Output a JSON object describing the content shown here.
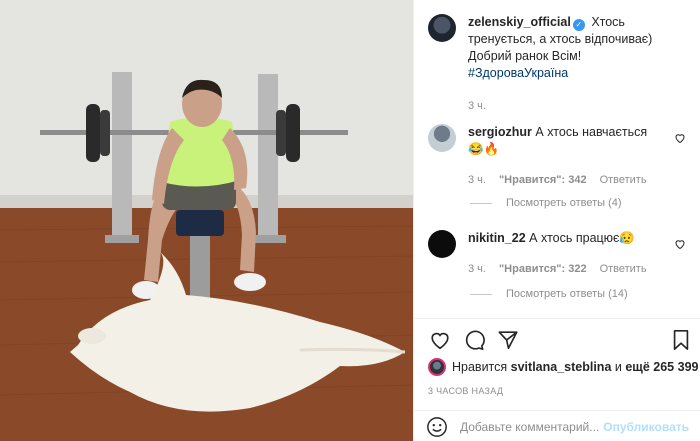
{
  "post": {
    "username": "zelenskiy_official",
    "verified_mark": "✓",
    "caption": "Хтось тренується, а хтось відпочиває) Добрий ранок Всім!",
    "hashtag": "#ЗдороваУкраїна",
    "time": "3 ч."
  },
  "comments": [
    {
      "username": "sergiozhur",
      "text": "А хтось навчається",
      "emoji": "😂🔥",
      "time": "3 ч.",
      "likes": "\"Нравится\": 342",
      "reply": "Ответить",
      "view_replies": "Посмотреть ответы (4)"
    },
    {
      "username": "nikitin_22",
      "text": "А хтось працює😥",
      "time": "3 ч.",
      "likes": "\"Нравится\": 322",
      "reply": "Ответить",
      "view_replies": "Посмотреть ответы (14)"
    }
  ],
  "likes_line": {
    "prefix": "Нравится",
    "user": "svitlana_steblina",
    "middle": "и",
    "rest": "ещё 265 399"
  },
  "time_ago": "3 ЧАСОВ НАЗАД",
  "add_comment": {
    "placeholder": "Добавьте комментарий...",
    "publish": "Опубликовать"
  },
  "icons": {
    "like": "heart-icon",
    "comment": "comment-icon",
    "share": "share-icon",
    "save": "bookmark-icon",
    "emoji": "emoji-icon"
  },
  "colors": {
    "link": "#00376b",
    "verified": "#3897f0",
    "muted": "#8e8e8e",
    "publish": "#b2dffc"
  }
}
